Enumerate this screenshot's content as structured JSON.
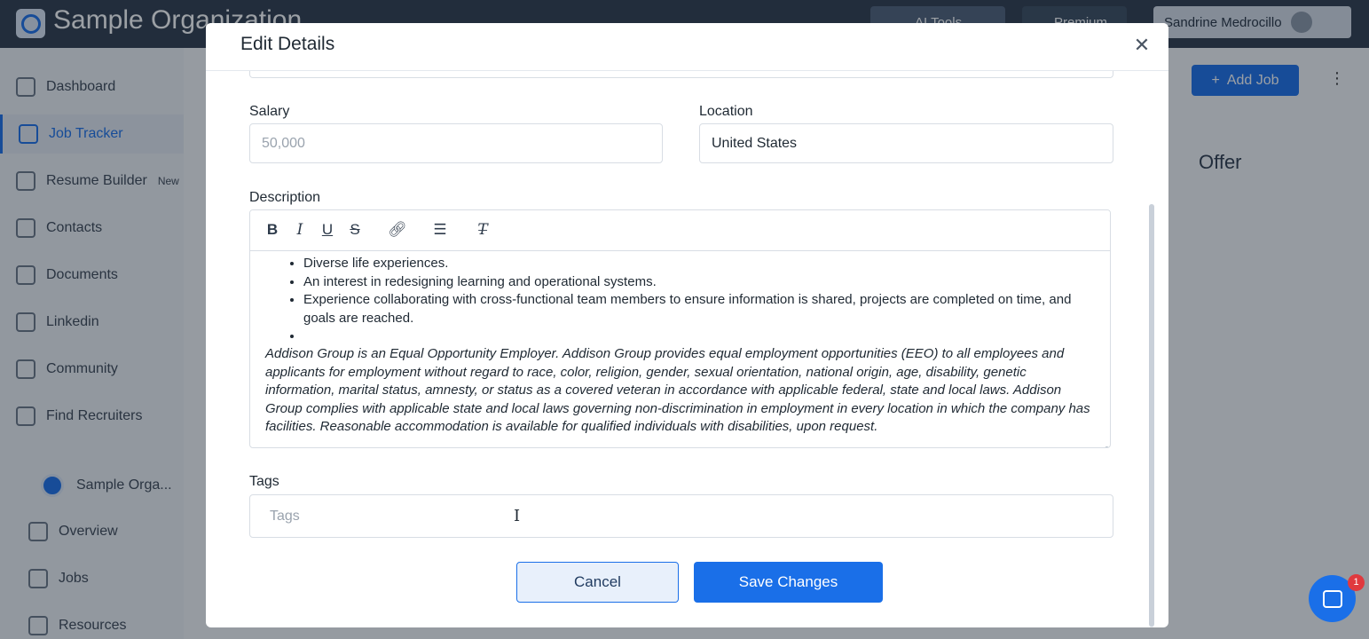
{
  "app": {
    "org_name": "Sample Organization",
    "ai_tools_label": "AI Tools",
    "premium_label": "Premium",
    "user_name": "Sandrine Medrocillo"
  },
  "sidebar": {
    "items": [
      {
        "label": "Dashboard"
      },
      {
        "label": "Job Tracker"
      },
      {
        "label": "Resume Builder",
        "badge": "New"
      },
      {
        "label": "Contacts"
      },
      {
        "label": "Documents"
      },
      {
        "label": "Linkedin"
      },
      {
        "label": "Community"
      },
      {
        "label": "Find Recruiters"
      }
    ],
    "org_label": "Sample Orga...",
    "sub_items": [
      {
        "label": "Overview"
      },
      {
        "label": "Jobs"
      },
      {
        "label": "Resources"
      }
    ]
  },
  "main": {
    "add_job_label": "Add Job",
    "offer_column": "Offer"
  },
  "modal": {
    "title": "Edit Details",
    "salary_label": "Salary",
    "salary_placeholder": "50,000",
    "location_label": "Location",
    "location_value": "United States",
    "description_label": "Description",
    "description_bullets": [
      "Diverse life experiences.",
      "An interest in redesigning learning and operational systems.",
      "Experience collaborating with cross-functional team members to ensure information is shared, projects are completed on time, and goals are reached.",
      ""
    ],
    "description_italic": "Addison Group is an Equal Opportunity Employer. Addison Group provides equal employment opportunities (EEO) to all employees and applicants for employment without regard to race, color, religion, gender, sexual orientation, national origin, age, disability, genetic information, marital status, amnesty, or status as a covered veteran in accordance with applicable federal, state and local laws. Addison Group complies with applicable state and local laws governing non-discrimination in employment in every location in which the company has facilities. Reasonable accommodation is available for qualified individuals with disabilities, upon request.",
    "tags_label": "Tags",
    "tags_placeholder": "Tags",
    "cancel_label": "Cancel",
    "save_label": "Save Changes"
  },
  "chat": {
    "badge_count": "1"
  },
  "colors": {
    "accent": "#1a6fe8",
    "topbar": "#2d3a4a"
  }
}
